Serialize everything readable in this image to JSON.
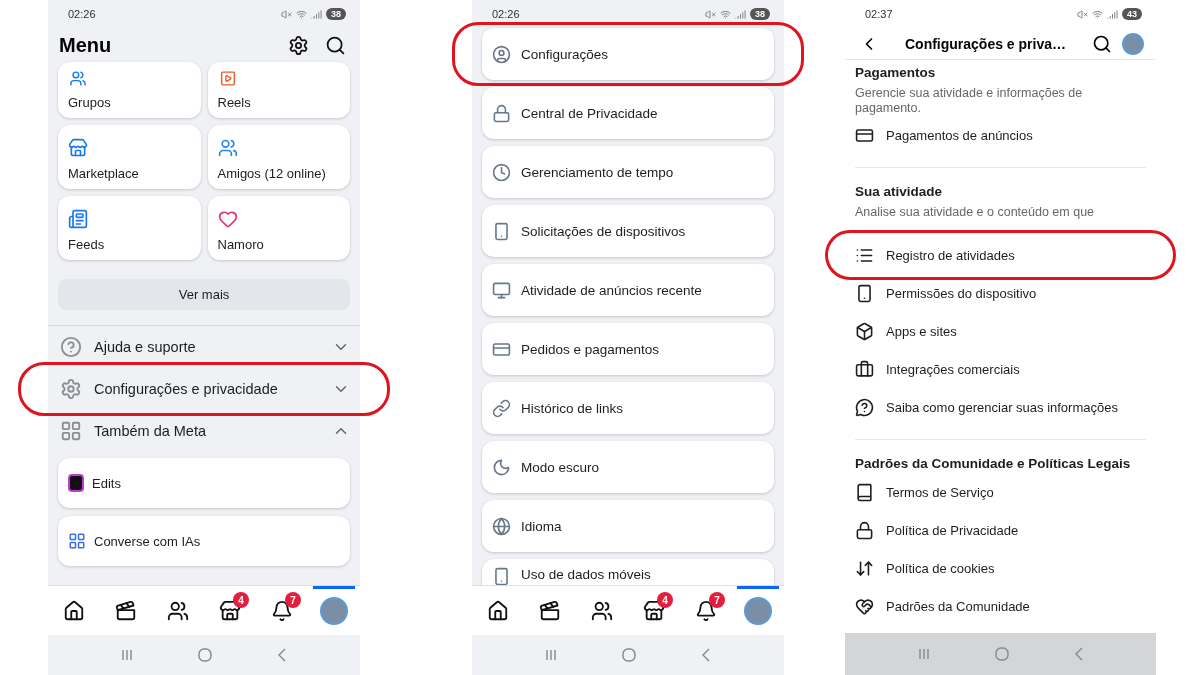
{
  "screens": [
    {
      "kind": "menu",
      "status_bar": {
        "time": "02:26",
        "battery": "38"
      },
      "title": "Menu",
      "shortcuts": [
        {
          "label": "Grupos"
        },
        {
          "label": "Reels"
        },
        {
          "label": "Marketplace"
        },
        {
          "label": "Amigos (12 online)"
        },
        {
          "label": "Feeds"
        },
        {
          "label": "Namoro"
        }
      ],
      "more_button": "Ver mais",
      "sections": [
        {
          "label": "Ajuda e suporte",
          "expanded": false,
          "highlighted": false
        },
        {
          "label": "Configurações e privacidade",
          "expanded": false,
          "highlighted": true
        },
        {
          "label": "Também da Meta",
          "expanded": true,
          "highlighted": false
        }
      ],
      "apps": [
        {
          "label": "Edits"
        },
        {
          "label": "Converse com IAs"
        }
      ],
      "tabs": [
        {
          "selected": false
        },
        {
          "selected": false
        },
        {
          "selected": false
        },
        {
          "selected": false,
          "badge": "4"
        },
        {
          "selected": false,
          "badge": "7"
        },
        {
          "selected": true
        }
      ]
    },
    {
      "kind": "settings_list",
      "status_bar": {
        "time": "02:26",
        "battery": "38"
      },
      "items": [
        {
          "label": "Configurações",
          "highlighted": true
        },
        {
          "label": "Central de Privacidade",
          "highlighted": false
        },
        {
          "label": "Gerenciamento de tempo",
          "highlighted": false
        },
        {
          "label": "Solicitações de dispositivos",
          "highlighted": false
        },
        {
          "label": "Atividade de anúncios recente",
          "highlighted": false
        },
        {
          "label": "Pedidos e pagamentos",
          "highlighted": false
        },
        {
          "label": "Histórico de links",
          "highlighted": false
        },
        {
          "label": "Modo escuro",
          "highlighted": false
        },
        {
          "label": "Idioma",
          "highlighted": false
        },
        {
          "label": "Uso de dados móveis",
          "highlighted": false
        }
      ],
      "tabs": [
        {
          "selected": false
        },
        {
          "selected": false
        },
        {
          "selected": false
        },
        {
          "selected": false,
          "badge": "4"
        },
        {
          "selected": false,
          "badge": "7"
        },
        {
          "selected": true
        }
      ]
    },
    {
      "kind": "settings_page",
      "status_bar": {
        "time": "02:37",
        "battery": "43"
      },
      "title": "Configurações e priva…",
      "groups": [
        {
          "heading": "Pagamentos",
          "description": "Gerencie sua atividade e informações de pagamento.",
          "items": [
            {
              "label": "Pagamentos de anúncios",
              "highlighted": false
            }
          ]
        },
        {
          "heading": "Sua atividade",
          "description": "Analise sua atividade e o conteúdo em que",
          "items": [
            {
              "label": "Registro de atividades",
              "highlighted": true
            },
            {
              "label": "Permissões do dispositivo",
              "highlighted": false
            },
            {
              "label": "Apps e sites",
              "highlighted": false
            },
            {
              "label": "Integrações comerciais",
              "highlighted": false
            },
            {
              "label": "Saiba como gerenciar suas informações",
              "highlighted": false
            }
          ]
        },
        {
          "heading": "Padrões da Comunidade e Políticas Legais",
          "items": [
            {
              "label": "Termos de Serviço",
              "highlighted": false
            },
            {
              "label": "Política de Privacidade",
              "highlighted": false
            },
            {
              "label": "Política de cookies",
              "highlighted": false
            },
            {
              "label": "Padrões da Comunidade",
              "highlighted": false
            }
          ]
        }
      ]
    }
  ]
}
